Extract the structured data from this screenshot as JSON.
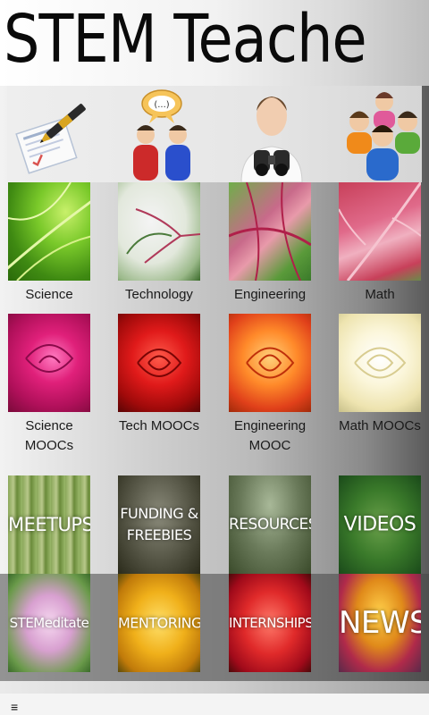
{
  "header": {
    "title": "STEM Teachers"
  },
  "icons": [
    {
      "name": "lesson-plan-icon"
    },
    {
      "name": "discussion-icon"
    },
    {
      "name": "research-binoculars-icon"
    },
    {
      "name": "community-group-icon"
    }
  ],
  "subjects": [
    {
      "label": "Science"
    },
    {
      "label": "Technology"
    },
    {
      "label": "Engineering"
    },
    {
      "label": "Math"
    }
  ],
  "moocs": [
    {
      "label": "Science MOOCs"
    },
    {
      "label": "Tech MOOCs"
    },
    {
      "label": "Engineering MOOC"
    },
    {
      "label": "Math MOOCs"
    }
  ],
  "resources": [
    {
      "text": "MEETUPS"
    },
    {
      "text": "FUNDING &\nFREEBIES"
    },
    {
      "text": "RESOURCES"
    },
    {
      "text": "VIDEOS"
    }
  ],
  "features": [
    {
      "text": "STEMeditate"
    },
    {
      "text": "MENTORING"
    },
    {
      "text": "INTERNSHIPS"
    },
    {
      "text": "NEWS"
    }
  ],
  "bottom": {
    "menu_icon": "≡"
  }
}
